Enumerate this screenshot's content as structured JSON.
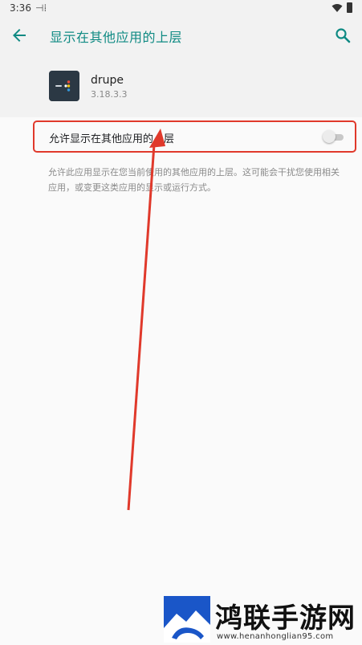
{
  "status": {
    "time": "3:36",
    "notification_glyph": "⊣⁞"
  },
  "appbar": {
    "title": "显示在其他应用的上层",
    "back_icon": "arrow-back",
    "search_icon": "search"
  },
  "app": {
    "name": "drupe",
    "version": "3.18.3.3"
  },
  "setting": {
    "label": "允许显示在其他应用的上层",
    "enabled": false
  },
  "description": "允许此应用显示在您当前使用的其他应用的上层。这可能会干扰您使用相关应用，或变更这类应用的显示或运行方式。",
  "colors": {
    "accent": "#0f8a83",
    "highlight": "#e0392b",
    "app_icon_bg": "#2b3844"
  },
  "watermark": {
    "title": "鸿联手游网",
    "url": "www.henanhonglian95.com"
  }
}
